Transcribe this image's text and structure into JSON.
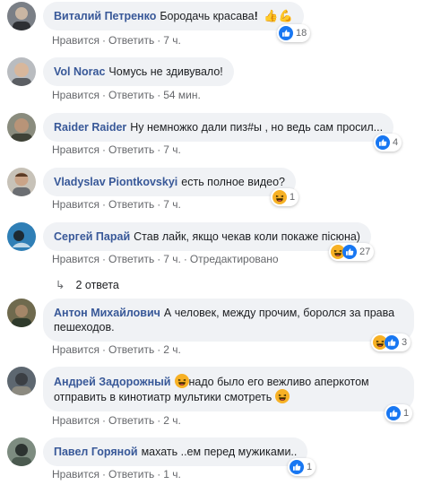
{
  "labels": {
    "like": "Нравится",
    "reply": "Ответить",
    "edited": "Отредактировано"
  },
  "comments": [
    {
      "author": "Виталий Петренко",
      "text": "Бородачь красава",
      "time": "7 ч.",
      "reactions": "18"
    },
    {
      "author": "Vol Norac",
      "text": "Чомусь не здивувало!",
      "time": "54 мин."
    },
    {
      "author": "Raider Raider",
      "text": "Ну немножко дали пиз#ы , но ведь сам просил...",
      "time": "7 ч.",
      "reactions": "4"
    },
    {
      "author": "Vladyslav Piontkovskyi",
      "text": "есть полное видео?",
      "time": "7 ч.",
      "reactions": "1"
    },
    {
      "author": "Сергей Парай",
      "text": "Став лайк, якщо чекав коли покаже пісюна)",
      "time": "7 ч.",
      "reactions": "27"
    },
    {
      "author": "Антон Михайлович",
      "text": "А человек, между прочим, боролся за права пешеходов.",
      "time": "2 ч.",
      "reactions": "3"
    },
    {
      "author": "Андрей Задорожный",
      "text_a": "надо было его вежливо аперкотом отправить в кинотиатр мультики смотреть",
      "time": "2 ч.",
      "reactions": "1"
    },
    {
      "author": "Павел Горяной",
      "text": "махать ..ем перед мужиками..",
      "time": "1 ч.",
      "reactions": "1"
    }
  ],
  "replies_link": "2 ответа",
  "colors": {
    "author": "#385898",
    "bubble": "#f0f2f5",
    "meta": "#65676b",
    "like_blue": "#1877f2",
    "haha_yellow": "#f7b125"
  }
}
